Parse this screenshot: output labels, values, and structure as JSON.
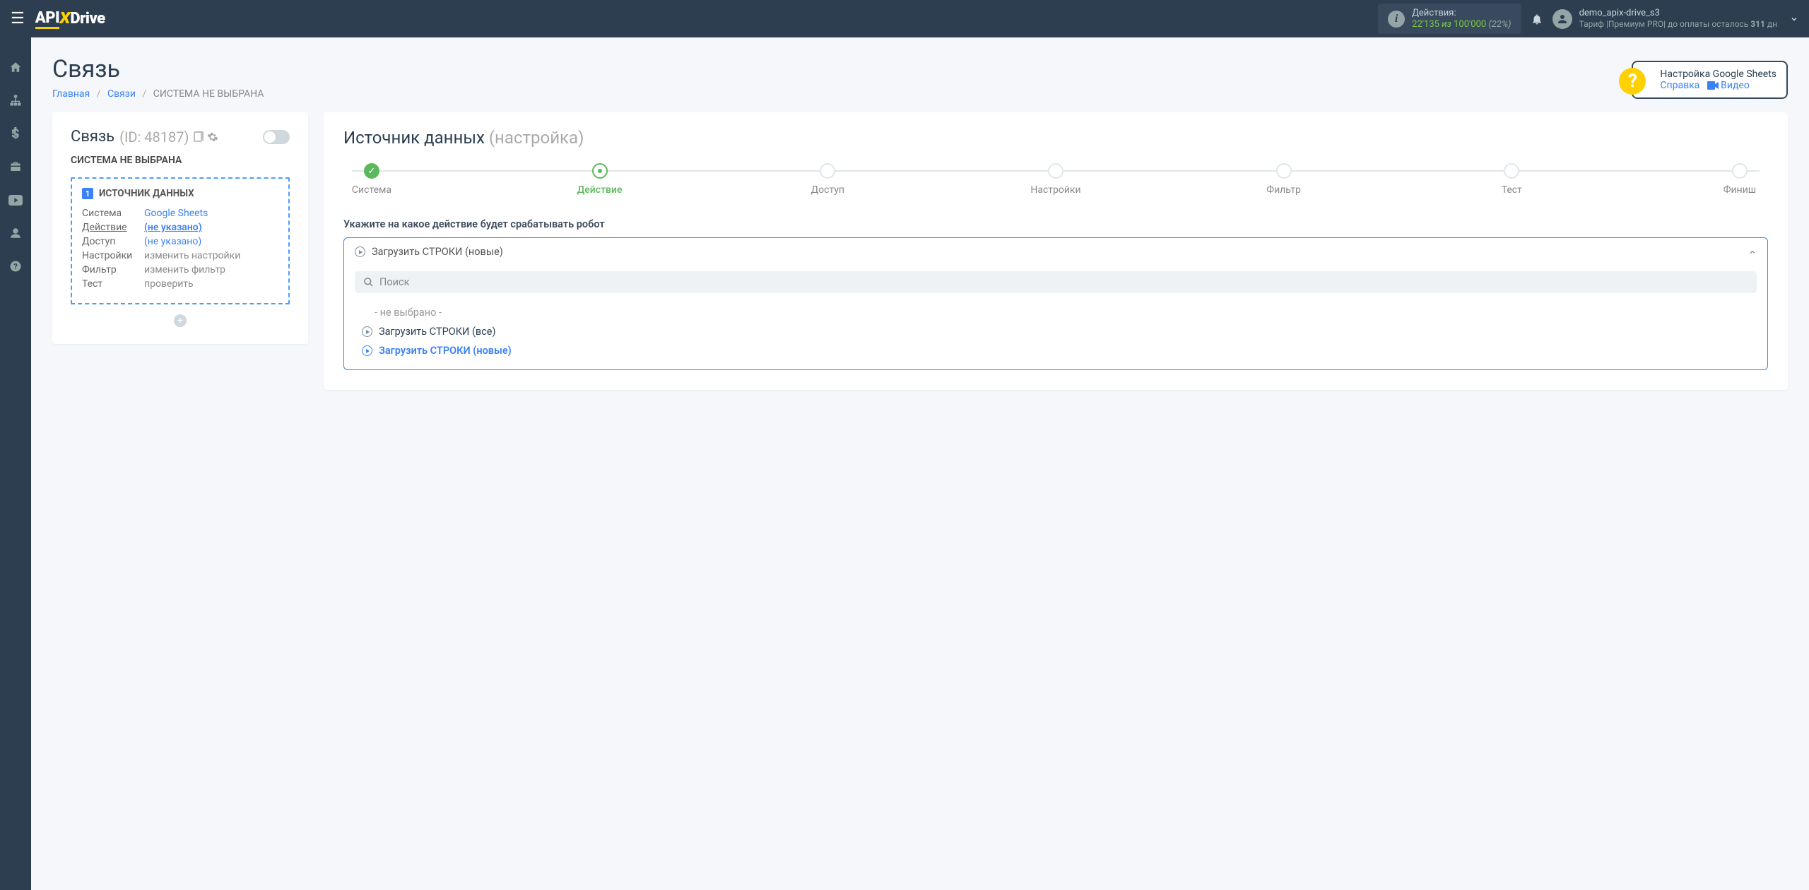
{
  "topbar": {
    "actions_label": "Действия:",
    "actions_used": "22'135",
    "actions_of": "из",
    "actions_total": "100'000",
    "actions_pct": "(22%)",
    "username": "demo_apix-drive_s3",
    "tariff_text": "Тариф |Премиум PRO| до оплаты осталось ",
    "days": "311",
    "days_suffix": " дн"
  },
  "page": {
    "title": "Связь",
    "breadcrumb": {
      "home": "Главная",
      "links": "Связи",
      "current": "СИСТЕМА НЕ ВЫБРАНА"
    }
  },
  "help": {
    "title": "Настройка Google Sheets",
    "link": "Справка",
    "video": "Видео"
  },
  "left": {
    "title": "Связь",
    "id": "(ID: 48187)",
    "subheader": "СИСТЕМА НЕ ВЫБРАНА",
    "box_title": "ИСТОЧНИК ДАННЫХ",
    "rows": {
      "system_k": "Система",
      "system_v": "Google Sheets",
      "action_k": "Действие",
      "action_v": "(не указано)",
      "access_k": "Доступ",
      "access_v": "(не указано)",
      "settings_k": "Настройки",
      "settings_v": "изменить настройки",
      "filter_k": "Фильтр",
      "filter_v": "изменить фильтр",
      "test_k": "Тест",
      "test_v": "проверить"
    }
  },
  "right": {
    "title": "Источник данных",
    "title_suffix": "(настройка)",
    "steps": [
      "Система",
      "Действие",
      "Доступ",
      "Настройки",
      "Фильтр",
      "Тест",
      "Финиш"
    ],
    "form_label": "Укажите на какое действие будет срабатывать робот",
    "selected": "Загрузить СТРОКИ (новые)",
    "search_placeholder": "Поиск",
    "options": {
      "none": "- не выбрано -",
      "all": "Загрузить СТРОКИ (все)",
      "new": "Загрузить СТРОКИ (новые)"
    }
  }
}
